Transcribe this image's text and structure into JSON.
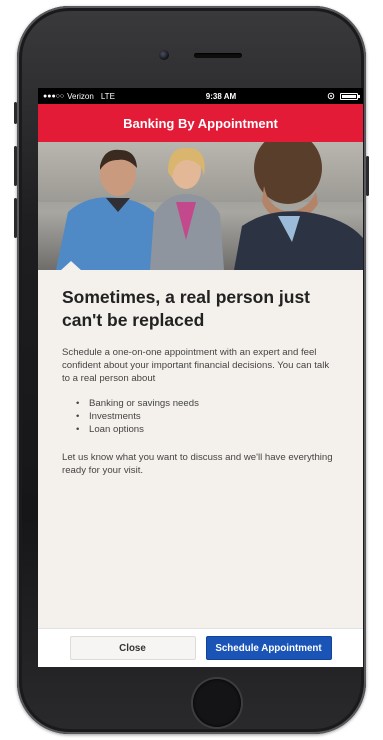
{
  "status_bar": {
    "carrier": "Verizon",
    "network": "LTE",
    "time": "9:38 AM"
  },
  "nav": {
    "title": "Banking By Appointment"
  },
  "content": {
    "headline": "Sometimes, a real person just can't be replaced",
    "intro": "Schedule a one-on-one appointment with an expert and feel confident about your important financial decisions. You can talk to a real person about",
    "bullets": [
      "Banking or savings needs",
      "Investments",
      "Loan options"
    ],
    "closing": "Let us know what you want to discuss and we'll have everything ready for your visit."
  },
  "footer": {
    "close_label": "Close",
    "schedule_label": "Schedule Appointment"
  },
  "colors": {
    "nav_bar": "#e31b37",
    "schedule_button": "#1a54b6",
    "content_background": "#f4f1ec"
  },
  "icons": [
    "wifi-signal-icon",
    "battery-icon",
    "camera-icon",
    "home-button-icon"
  ]
}
